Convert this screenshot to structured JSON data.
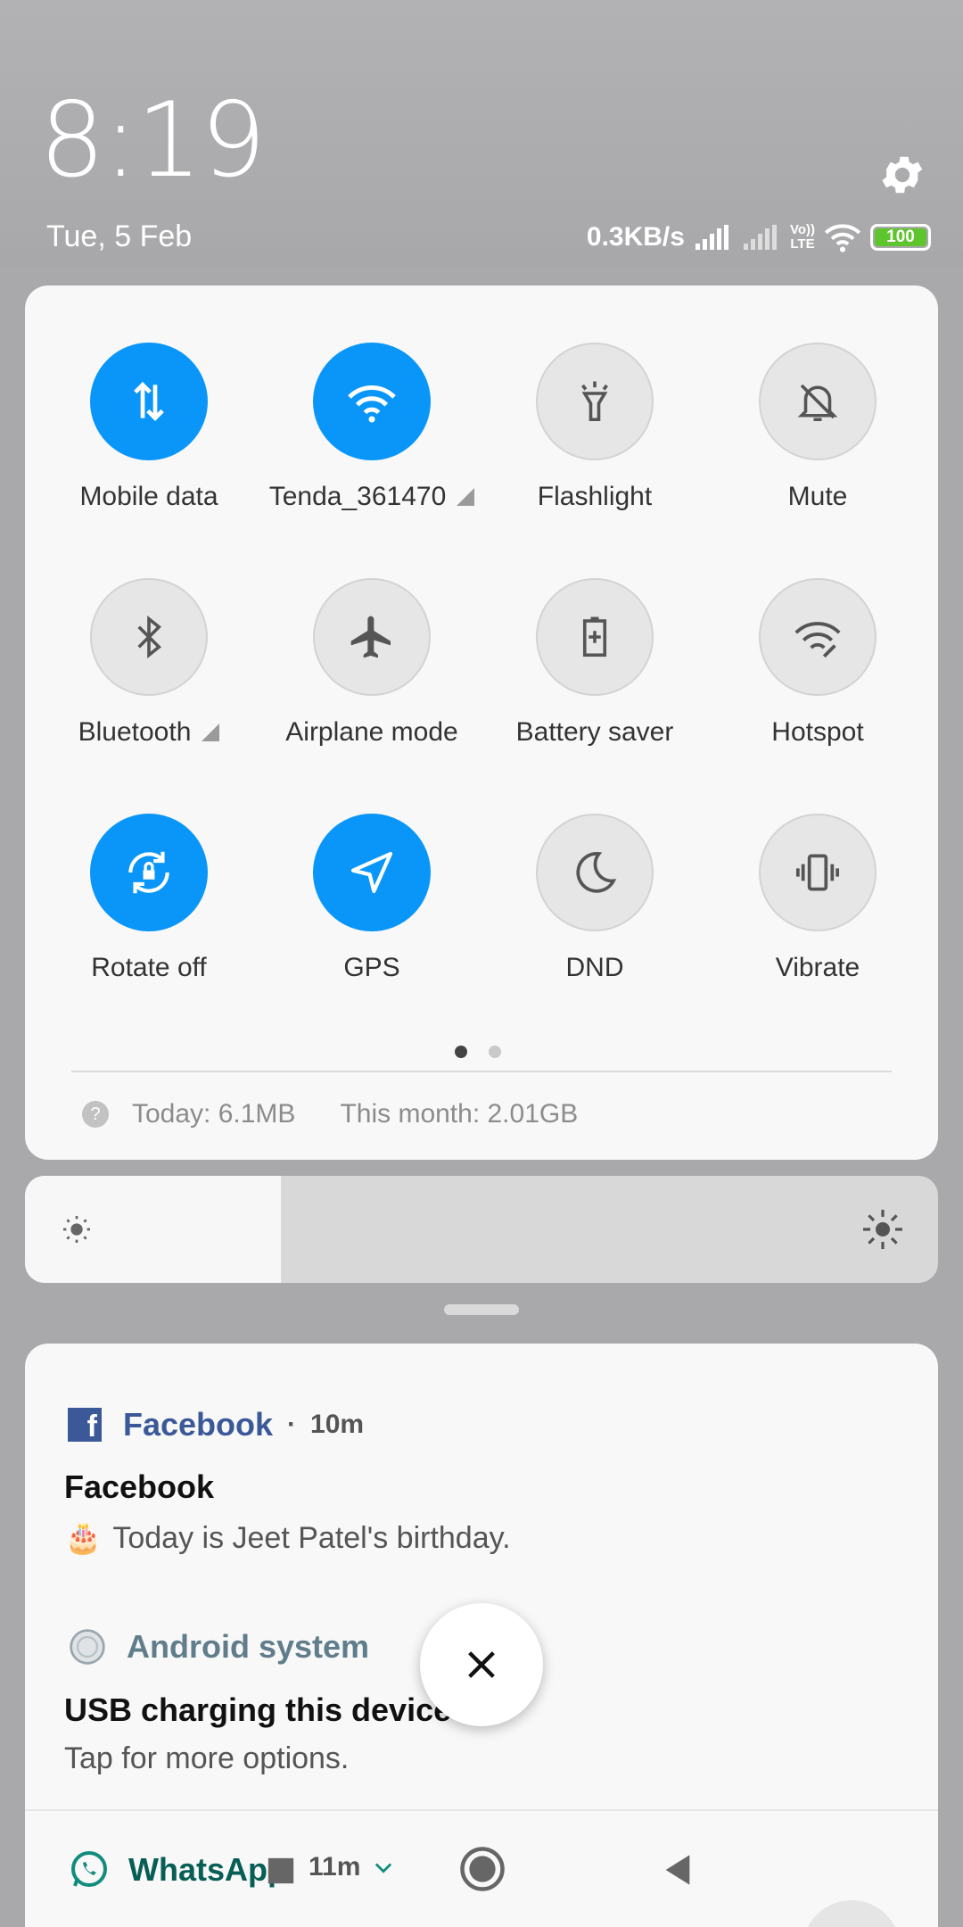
{
  "status": {
    "time": "8:19",
    "date": "Tue, 5 Feb",
    "network_speed": "0.3KB/s",
    "volte_label_top": "Vo))",
    "volte_label_bottom": "LTE",
    "battery_level": "100",
    "battery_color": "#5fc52f"
  },
  "quick_settings": {
    "accent_color": "#0a96f9",
    "tiles": [
      {
        "label": "Mobile data",
        "icon": "mobile-data-icon",
        "active": true
      },
      {
        "label": "Tenda_361470",
        "icon": "wifi-icon",
        "active": true
      },
      {
        "label": "Flashlight",
        "icon": "flashlight-icon",
        "active": false
      },
      {
        "label": "Mute",
        "icon": "bell-off-icon",
        "active": false
      },
      {
        "label": "Bluetooth",
        "icon": "bluetooth-icon",
        "active": false
      },
      {
        "label": "Airplane mode",
        "icon": "airplane-icon",
        "active": false
      },
      {
        "label": "Battery saver",
        "icon": "battery-saver-icon",
        "active": false
      },
      {
        "label": "Hotspot",
        "icon": "hotspot-icon",
        "active": false
      },
      {
        "label": "Rotate off",
        "icon": "rotate-lock-icon",
        "active": true
      },
      {
        "label": "GPS",
        "icon": "gps-icon",
        "active": true
      },
      {
        "label": "DND",
        "icon": "moon-icon",
        "active": false
      },
      {
        "label": "Vibrate",
        "icon": "vibrate-icon",
        "active": false
      }
    ],
    "page_count": 2,
    "current_page": 1,
    "usage_today": "Today: 6.1MB",
    "usage_month": "This month: 2.01GB"
  },
  "brightness": {
    "level_percent": 28
  },
  "notifications": {
    "facebook": {
      "app": "Facebook",
      "time": "10m",
      "title": "Facebook",
      "body": "Today is Jeet Patel's birthday.",
      "emoji": "🎂",
      "icon_letter": "f"
    },
    "android": {
      "app": "Android system",
      "title": "USB charging this device",
      "body": "Tap for more options."
    },
    "whatsapp": {
      "app": "WhatsApp",
      "time": "11m"
    }
  }
}
